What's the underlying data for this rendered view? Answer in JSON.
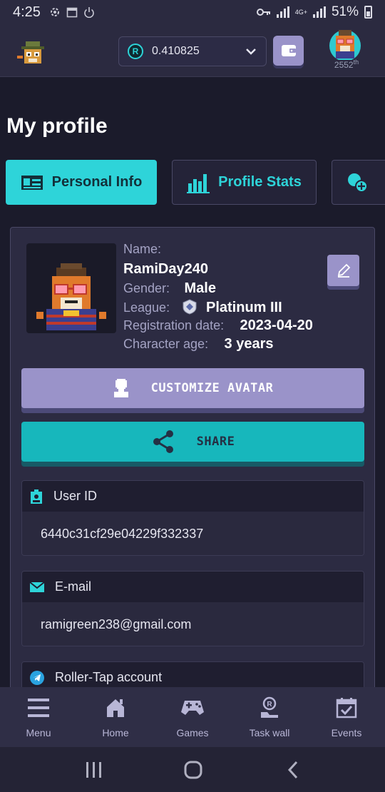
{
  "status_bar": {
    "time": "4:25",
    "network": "4G+",
    "battery": "51%"
  },
  "header": {
    "balance": "0.410825",
    "coin_symbol": "R",
    "rank_number": "2552",
    "rank_suffix": "th"
  },
  "page": {
    "title": "My profile"
  },
  "tabs": [
    {
      "label": "Personal Info",
      "active": true
    },
    {
      "label": "Profile Stats",
      "active": false
    },
    {
      "label": "",
      "active": false
    }
  ],
  "profile": {
    "name_label": "Name:",
    "name": "RamiDay240",
    "gender_label": "Gender:",
    "gender": "Male",
    "league_label": "League:",
    "league": "Platinum III",
    "registration_label": "Registration date:",
    "registration_date": "2023-04-20",
    "age_label": "Character age:",
    "age": "3 years"
  },
  "buttons": {
    "customize": "CUSTOMIZE AVATAR",
    "share": "SHARE"
  },
  "fields": {
    "user_id": {
      "label": "User ID",
      "value": "6440c31cf29e04229f332337"
    },
    "email": {
      "label": "E-mail",
      "value": "ramigreen238@gmail.com"
    },
    "roller_tap": {
      "label": "Roller-Tap account"
    }
  },
  "bottom_nav": [
    {
      "label": "Menu",
      "icon": "menu-icon"
    },
    {
      "label": "Home",
      "icon": "home-icon"
    },
    {
      "label": "Games",
      "icon": "gamepad-icon"
    },
    {
      "label": "Task wall",
      "icon": "task-wall-icon"
    },
    {
      "label": "Events",
      "icon": "events-icon"
    }
  ],
  "colors": {
    "accent": "#2ed4d9",
    "purple": "#9a93c9",
    "background": "#1b1b2b",
    "card": "#2c2b42"
  }
}
